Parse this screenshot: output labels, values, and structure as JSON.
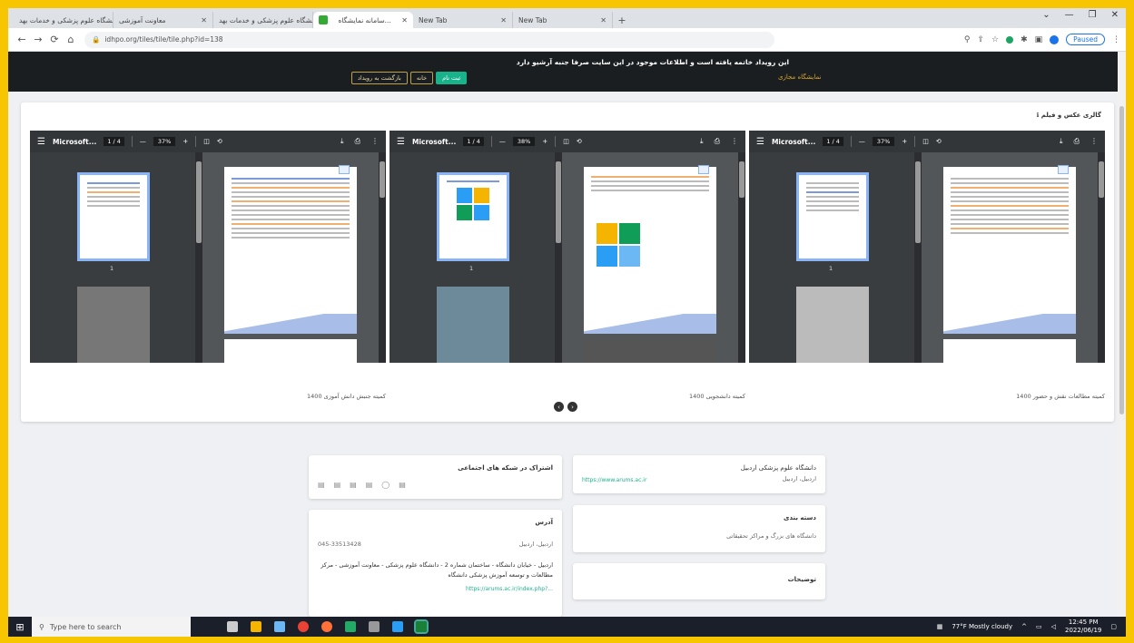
{
  "browser": {
    "tabs": [
      {
        "label": "دانشگاه علوم پزشکی و خدمات بهد...",
        "active": false
      },
      {
        "label": "معاونت آموزشی",
        "active": false
      },
      {
        "label": "دانشگاه علوم پزشکی و خدمات بهد...",
        "active": false
      },
      {
        "label": "سامانه نمایشگاه...",
        "active": true
      },
      {
        "label": "New Tab",
        "active": false
      },
      {
        "label": "New Tab",
        "active": false
      }
    ],
    "new_tab": "+",
    "window_controls": [
      "⌄",
      "—",
      "❐",
      "✕"
    ],
    "url": "idhpo.org/tiles/tile/tile.php?id=138",
    "profile": "Paused"
  },
  "banner": {
    "message": "این رویداد خاتمه یافته است و اطلاعات موجود در این سایت صرفا جنبه آرشیو دارد",
    "buttons": {
      "join": "ثبت نام",
      "home": "خانه",
      "back": "بازگشت به رویداد"
    },
    "brand": "نمایشگاه مجازی"
  },
  "gallery": {
    "heading": "ℹ گالری عکس و فیلم",
    "viewers": [
      {
        "title": "Microsoft...",
        "page": "1 / 4",
        "zoom": "37%",
        "caption": "کمیته جنبش دانش آموزی 1400"
      },
      {
        "title": "Microsoft...",
        "page": "1 / 4",
        "zoom": "38%",
        "caption": "کمیته دانشجویی 1400"
      },
      {
        "title": "Microsoft...",
        "page": "1 / 4",
        "zoom": "37%",
        "caption": "کمیته مطالعات نقش و حضور 1400"
      }
    ],
    "prev": "‹",
    "next": "›"
  },
  "info": {
    "org_name": "دانشگاه علوم پزشکی اردبیل",
    "org_location": "اردبیل، اردبیل",
    "org_link": "https://www.arums.ac.ir",
    "share_title": "اشتراک در شبکه های اجتماعی",
    "category_title": "دسته بندی",
    "category_value": "دانشگاه های بزرگ و مراکز تحقیقاتی",
    "address_title": "آدرس",
    "address_city": "اردبیل، اردبیل",
    "address_phone": "045-33513428",
    "address_text": "اردبیل - خیابان دانشگاه - ساختمان شماره 2 - دانشگاه علوم پزشکی - معاونت آموزشی - مرکز مطالعات و توسعه آموزش پزشکی دانشگاه",
    "address_link": "https://arums.ac.ir/index.php?...",
    "desc_title": "توضیحات"
  },
  "taskbar": {
    "search": "Type here to search",
    "weather": "77°F  Mostly cloudy",
    "time": "12:45 PM",
    "date": "2022/06/19"
  }
}
